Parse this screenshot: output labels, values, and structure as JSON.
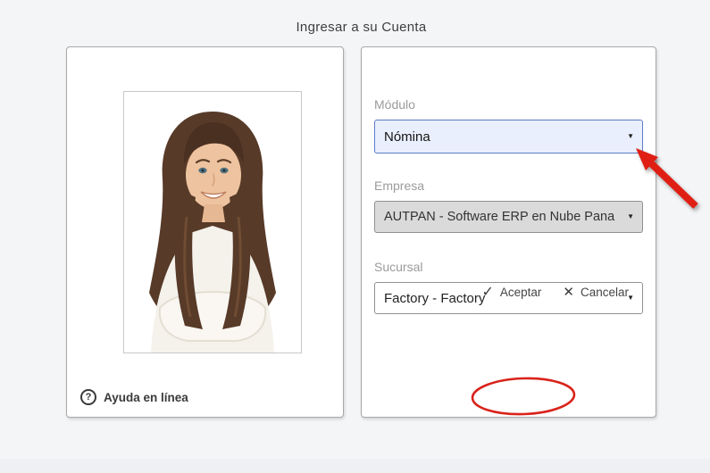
{
  "title": "Ingresar a su Cuenta",
  "form": {
    "modulo": {
      "label": "Módulo",
      "value": "Nómina"
    },
    "empresa": {
      "label": "Empresa",
      "value": "AUTPAN - Software ERP en Nube Pana"
    },
    "sucursal": {
      "label": "Sucursal",
      "value": "Factory - Factory"
    }
  },
  "actions": {
    "accept_label": "Aceptar",
    "cancel_label": "Cancelar"
  },
  "help_label": "Ayuda en línea",
  "glyphs": {
    "caret": "▼",
    "check": "✓",
    "cross": "✕",
    "question": "?"
  },
  "icons": {
    "help": "question-circle-icon",
    "accept": "check-icon",
    "cancel": "x-icon",
    "dropdown": "caret-down-icon"
  },
  "colors": {
    "page_bg": "#f4f5f7",
    "focused_select_border": "#5b7cc7",
    "focused_select_bg": "#e9effc",
    "disabled_select_bg": "#dadada",
    "annotation_red": "#d9231b"
  },
  "annotations": {
    "arrow_points_to": "modulo-select",
    "ellipse_surrounds": "accept-button"
  }
}
